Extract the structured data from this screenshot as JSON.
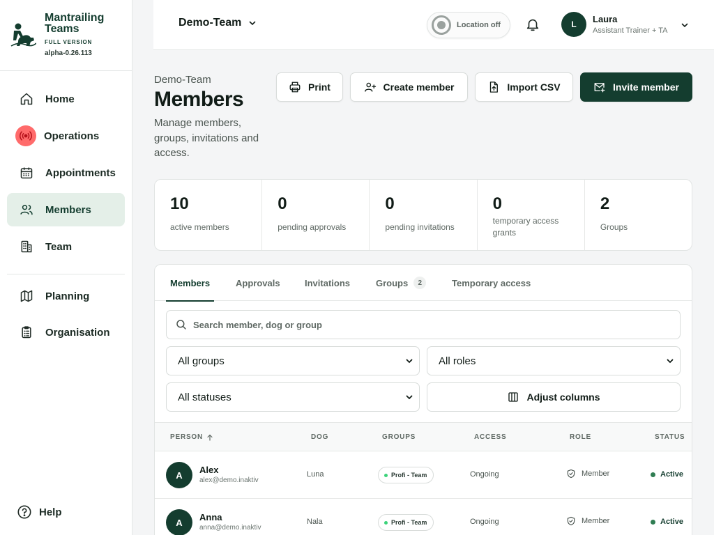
{
  "brand": {
    "name": "Mantrailing Teams",
    "version_tag": "FULL VERSION",
    "build": "alpha-0.26.113"
  },
  "nav": {
    "items": [
      {
        "label": "Home",
        "icon": "home-icon"
      },
      {
        "label": "Operations",
        "icon": "broadcast-icon"
      },
      {
        "label": "Appointments",
        "icon": "calendar-icon"
      },
      {
        "label": "Members",
        "icon": "users-icon",
        "active": true
      },
      {
        "label": "Team",
        "icon": "building-icon"
      }
    ],
    "secondary": [
      {
        "label": "Planning",
        "icon": "map-icon"
      },
      {
        "label": "Organisation",
        "icon": "clipboard-icon"
      }
    ],
    "help_label": "Help"
  },
  "topbar": {
    "team": "Demo-Team",
    "location": "Location off",
    "user": {
      "initial": "L",
      "name": "Laura",
      "role": "Assistant Trainer + TA"
    }
  },
  "header": {
    "crumb": "Demo-Team",
    "title": "Members",
    "subtitle": "Manage members, groups, invitations and access.",
    "actions": {
      "print": "Print",
      "create": "Create member",
      "import": "Import CSV",
      "invite": "Invite member"
    }
  },
  "stats": [
    {
      "value": "10",
      "label": "active members"
    },
    {
      "value": "0",
      "label": "pending approvals"
    },
    {
      "value": "0",
      "label": "pending invitations"
    },
    {
      "value": "0",
      "label": "temporary access grants"
    },
    {
      "value": "2",
      "label": "Groups"
    }
  ],
  "tabs": [
    {
      "label": "Members",
      "active": true
    },
    {
      "label": "Approvals"
    },
    {
      "label": "Invitations"
    },
    {
      "label": "Groups",
      "count": "2"
    },
    {
      "label": "Temporary access"
    }
  ],
  "filters": {
    "search_placeholder": "Search member, dog or group",
    "groups": "All groups",
    "roles": "All roles",
    "statuses": "All statuses",
    "adjust_columns": "Adjust columns"
  },
  "table": {
    "columns": {
      "person": "PERSON",
      "dog": "DOG",
      "groups": "GROUPS",
      "access": "ACCESS",
      "role": "ROLE",
      "status": "STATUS"
    },
    "rows": [
      {
        "initial": "A",
        "name": "Alex",
        "email": "alex@demo.inaktiv",
        "dog": "Luna",
        "group": "Profi - Team",
        "access": "Ongoing",
        "role": "Member",
        "status": "Active"
      },
      {
        "initial": "A",
        "name": "Anna",
        "email": "anna@demo.inaktiv",
        "dog": "Nala",
        "group": "Profi - Team",
        "access": "Ongoing",
        "role": "Member",
        "status": "Active"
      }
    ]
  },
  "colors": {
    "primary": "#143d2f",
    "active_nav_bg": "#e4efe8",
    "operations_badge": "#ff6b6b",
    "status_dot": "#2f7d52"
  }
}
